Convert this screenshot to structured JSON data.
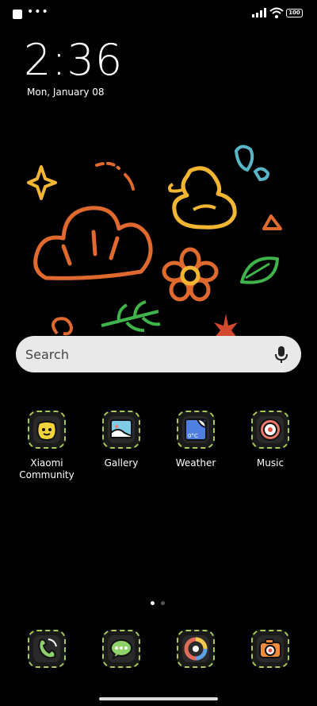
{
  "status_bar": {
    "left_icons": [
      "notification-square",
      "more-dots"
    ],
    "battery": "100"
  },
  "lockclock": {
    "time": "2:36",
    "date": "Mon, January 08"
  },
  "search": {
    "placeholder": "Search"
  },
  "apps": [
    {
      "label": "Xiaomi\nCommunity",
      "icon": "xiaomi-community-icon"
    },
    {
      "label": "Gallery",
      "icon": "gallery-icon"
    },
    {
      "label": "Weather",
      "icon": "weather-icon"
    },
    {
      "label": "Music",
      "icon": "music-icon"
    }
  ],
  "weather_icon_text": "0°C",
  "dock": [
    {
      "name": "phone",
      "icon": "phone-icon"
    },
    {
      "name": "messages",
      "icon": "messages-icon"
    },
    {
      "name": "browser",
      "icon": "browser-icon"
    },
    {
      "name": "camera",
      "icon": "camera-icon"
    }
  ],
  "pages": {
    "count": 2,
    "active": 1
  },
  "colors": {
    "background": "#000000",
    "search_bg": "#e9e9e9",
    "icon_border": "#a7c957",
    "doodle_orange": "#e0692d",
    "doodle_yellow": "#f2b632",
    "doodle_green": "#3fb44a",
    "doodle_teal": "#59b6c9"
  }
}
